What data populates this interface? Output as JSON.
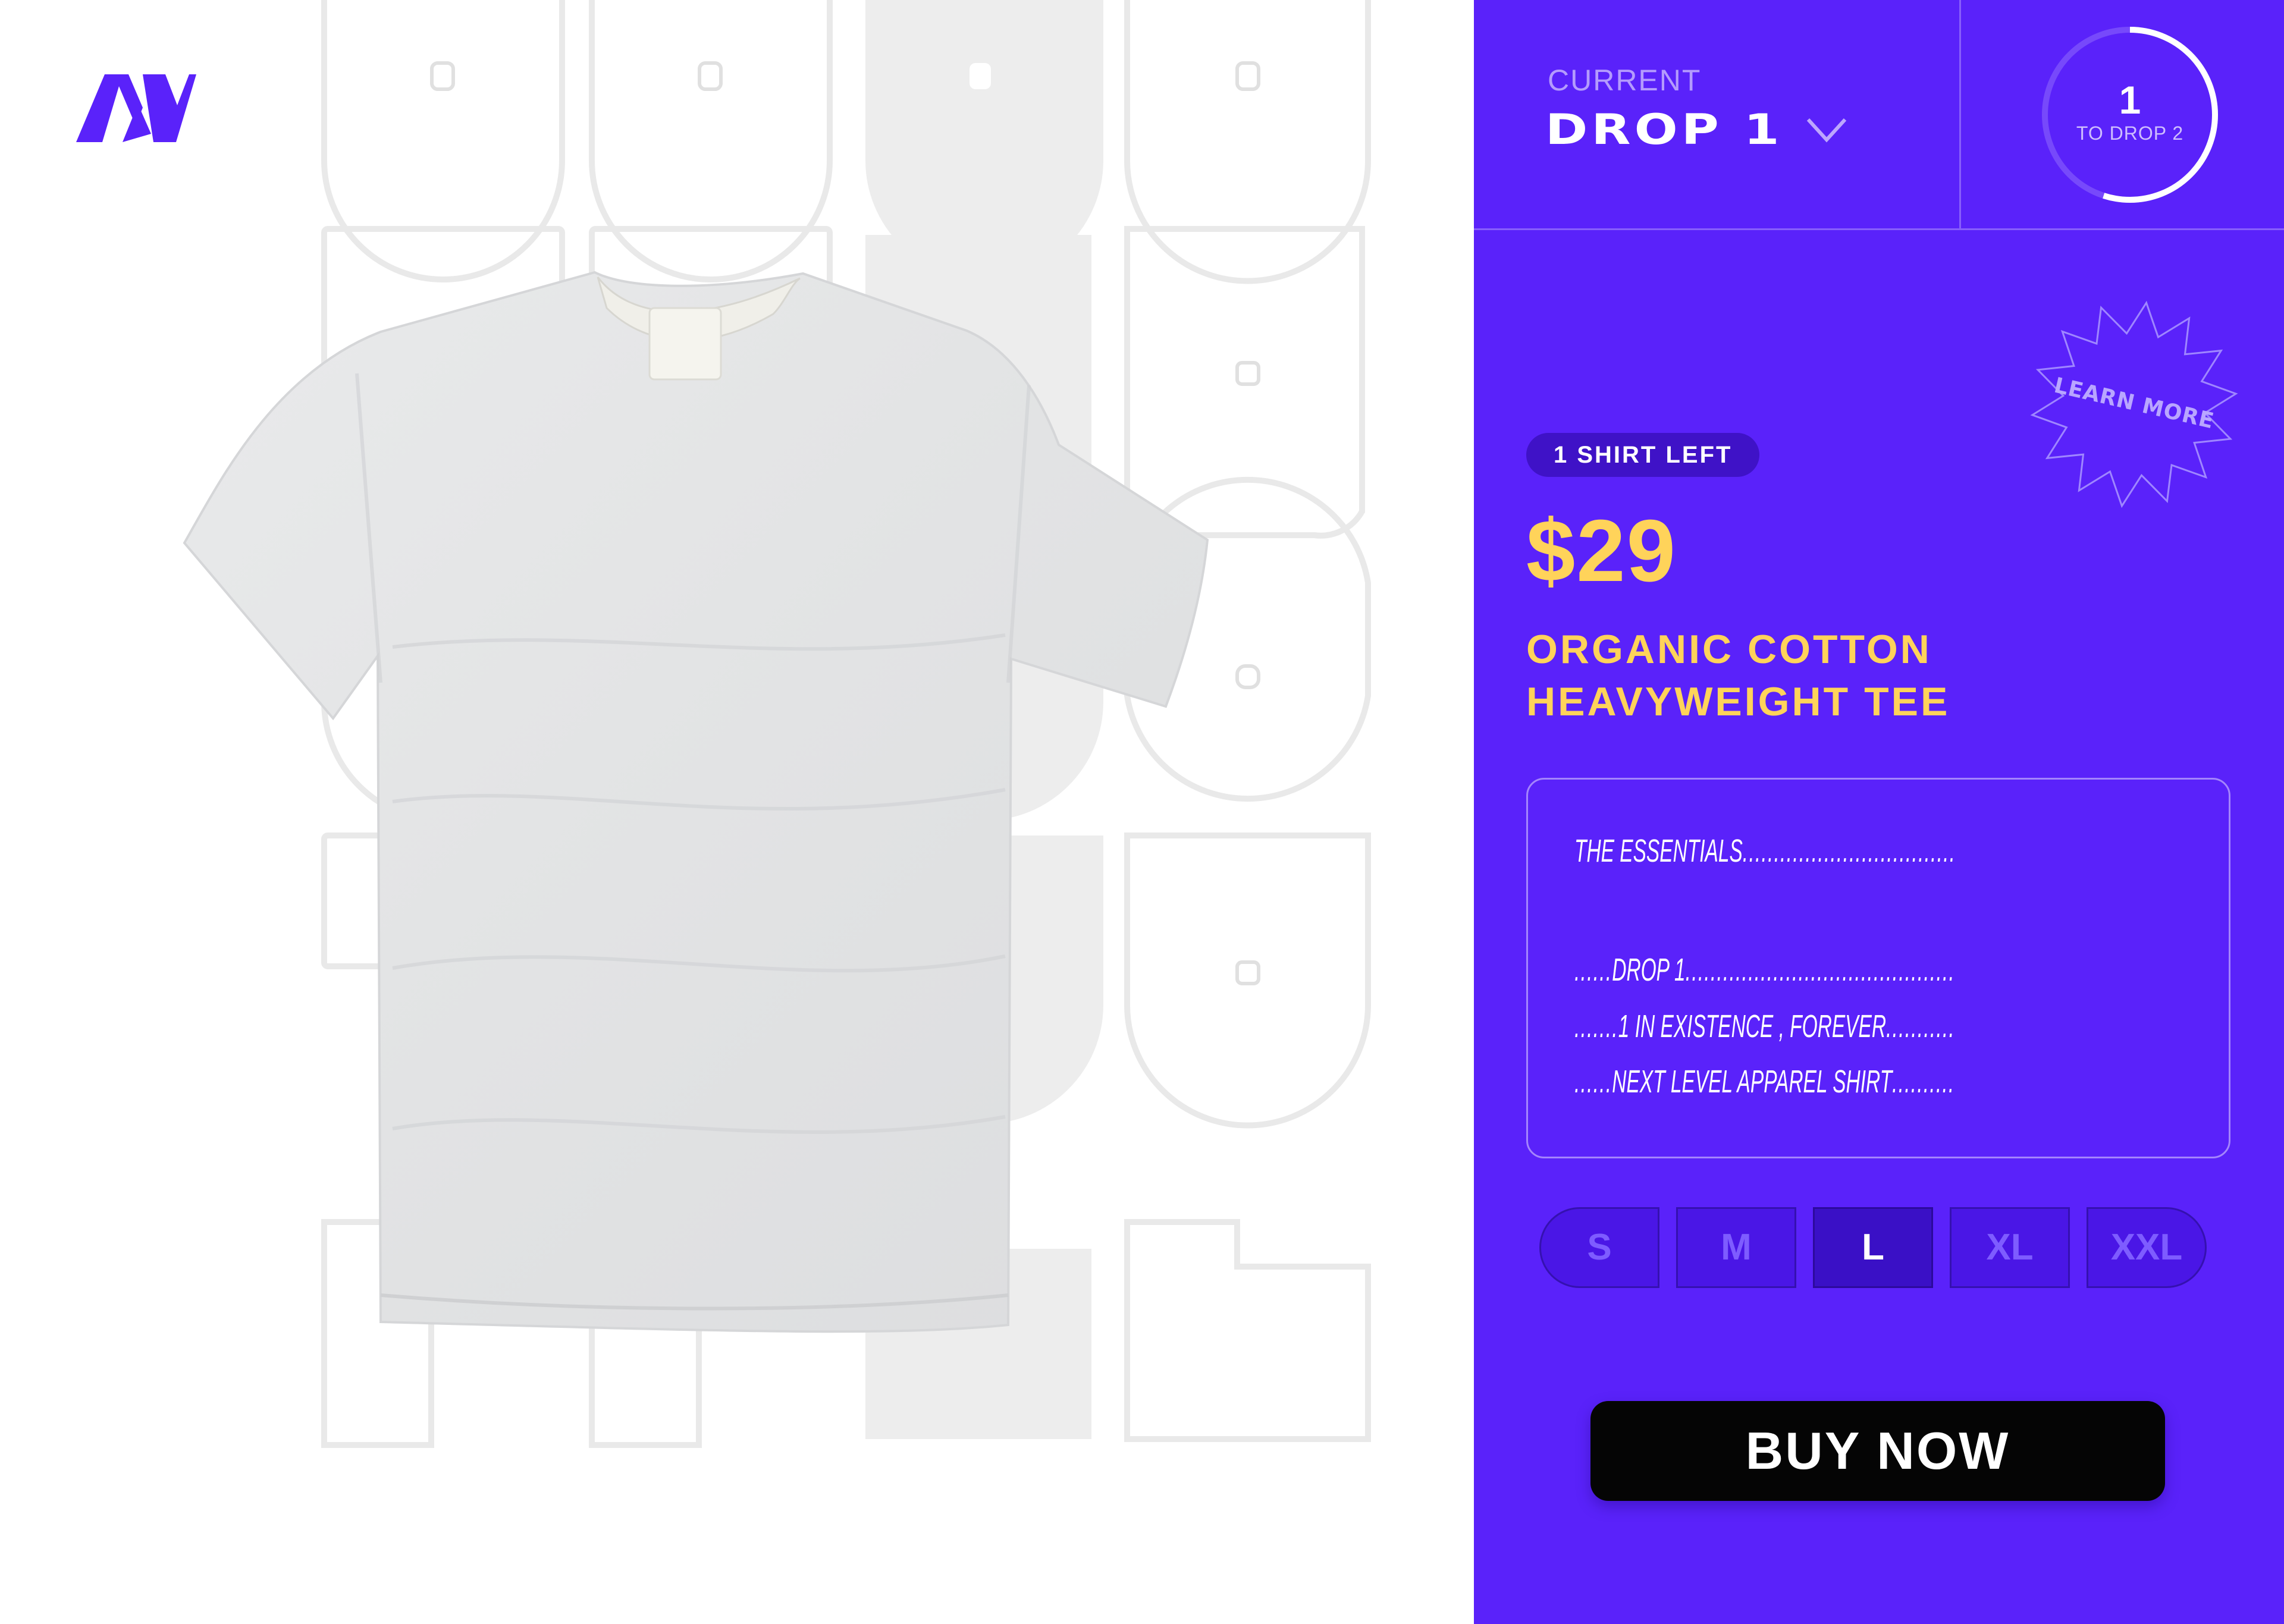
{
  "brand": {
    "logo_icon": "brand-logo-icon",
    "accent_color": "#5a22fa",
    "highlight_color": "#ffd35a"
  },
  "drop_selector": {
    "label": "CURRENT",
    "value": "DROP 1",
    "icon": "chevron-down-icon"
  },
  "countdown": {
    "number": "1",
    "label": "TO DROP 2",
    "progress": 0.55
  },
  "learn_more": {
    "label": "LEARN MORE",
    "icon": "starburst-badge-icon"
  },
  "product": {
    "stock_badge": "1 SHIRT LEFT",
    "price": "$29",
    "name_line1": "ORGANIC COTTON",
    "name_line2": "HEAVYWEIGHT TEE",
    "image": "t-shirt-image"
  },
  "details": {
    "line1": {
      "text": "THE ESSENTIALS ",
      "dots_after": ".............................................................."
    },
    "line2": {
      "dots_before": "......",
      "text": "DROP 1",
      "dots_after": "............................................................................."
    },
    "line3": {
      "dots_before": ".......",
      "text": "1 IN EXISTENCE , FOREVER",
      "dots_after": "........................................................"
    },
    "line4": {
      "dots_before": "......",
      "text": "NEXT LEVEL APPAREL SHIRT",
      "dots_after": "......................................................"
    }
  },
  "sizes": {
    "options": [
      "S",
      "M",
      "L",
      "XL",
      "XXL"
    ],
    "selected": "L"
  },
  "cta": {
    "label": "BUY NOW"
  }
}
